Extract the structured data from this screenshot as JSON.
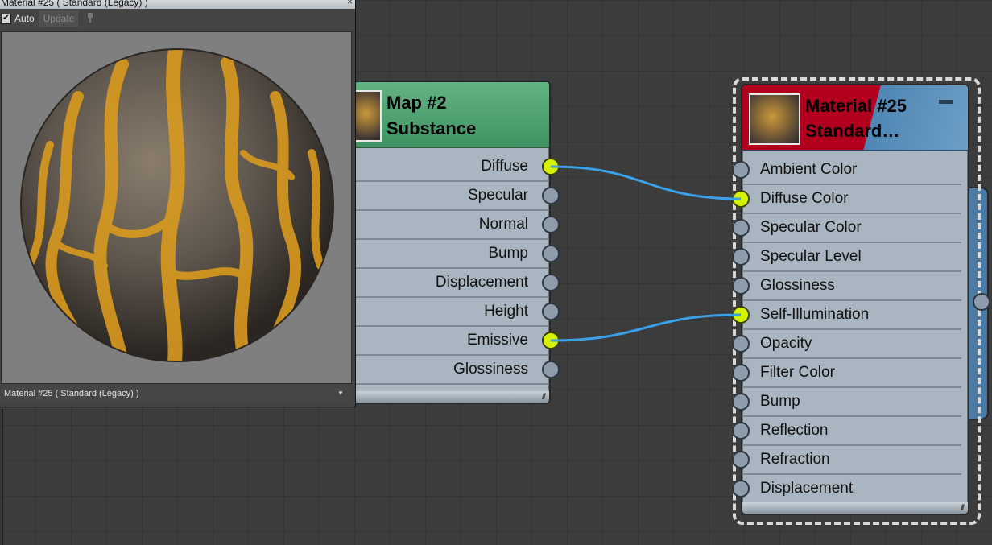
{
  "preview": {
    "title": "Material #25  ( Standard (Legacy) )",
    "auto_label": "Auto",
    "auto_checked": true,
    "update_label": "Update",
    "selected_material": "Material #25  ( Standard (Legacy) )"
  },
  "map_node": {
    "title_line1": "Map #2",
    "title_line2": "Substance",
    "outputs": [
      {
        "label": "Diffuse",
        "connected": true
      },
      {
        "label": "Specular",
        "connected": false
      },
      {
        "label": "Normal",
        "connected": false
      },
      {
        "label": "Bump",
        "connected": false
      },
      {
        "label": "Displacement",
        "connected": false
      },
      {
        "label": "Height",
        "connected": false
      },
      {
        "label": "Emissive",
        "connected": true
      },
      {
        "label": "Glossiness",
        "connected": false
      }
    ]
  },
  "material_node": {
    "title_line1": "Material #25",
    "title_line2": "Standard…",
    "inputs": [
      {
        "label": "Ambient Color",
        "connected": false
      },
      {
        "label": "Diffuse Color",
        "connected": true
      },
      {
        "label": "Specular Color",
        "connected": false
      },
      {
        "label": "Specular Level",
        "connected": false
      },
      {
        "label": "Glossiness",
        "connected": false
      },
      {
        "label": "Self-Illumination",
        "connected": true
      },
      {
        "label": "Opacity",
        "connected": false
      },
      {
        "label": "Filter Color",
        "connected": false
      },
      {
        "label": "Bump",
        "connected": false
      },
      {
        "label": "Reflection",
        "connected": false
      },
      {
        "label": "Refraction",
        "connected": false
      },
      {
        "label": "Displacement",
        "connected": false
      }
    ]
  },
  "wires": [
    {
      "from": "Diffuse",
      "to": "Diffuse Color"
    },
    {
      "from": "Emissive",
      "to": "Self-Illumination"
    }
  ],
  "colors": {
    "wire": "#3aa0e8",
    "active_socket": "#d7f200",
    "map_header": "#4f9f6f",
    "material_header_red": "#b3001f",
    "material_header_blue": "#5a8fbd"
  }
}
